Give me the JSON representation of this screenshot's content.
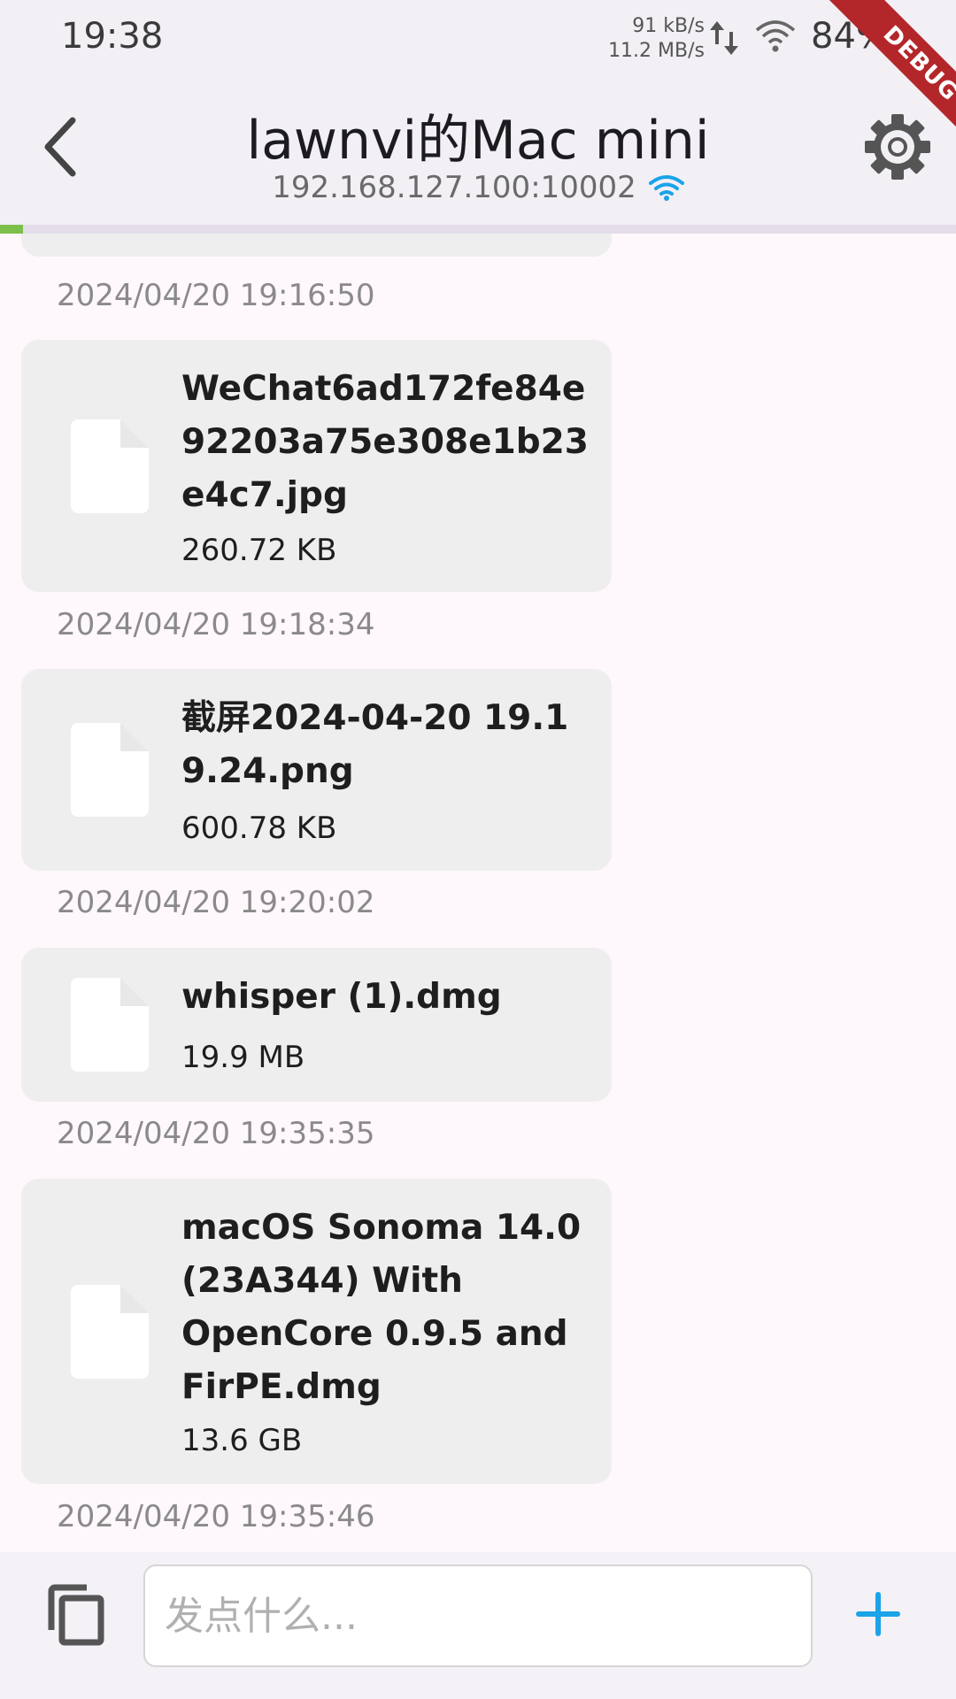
{
  "status_bar": {
    "time": "19:38",
    "upload_speed": "91 kB/s",
    "download_speed": "11.2 MB/s",
    "battery": "84%",
    "debug_label": "DEBUG"
  },
  "app_bar": {
    "title": "lawnvi的Mac mini",
    "address": "192.168.127.100:10002",
    "connection_color": "#1aa3e8",
    "progress_fraction": 0.024,
    "progress_color": "#7cc04b"
  },
  "messages": [
    {
      "name": "WeChat6ad172fe84e92203a75e308e1b23e4c7.jpg",
      "size": "260.72 KB",
      "time": "2024/04/20 19:18:34"
    },
    {
      "name": "截屏2024-04-20 19.19.24.png",
      "size": "600.78 KB",
      "time": "2024/04/20 19:20:02"
    },
    {
      "name": "whisper (1).dmg",
      "size": "19.9 MB",
      "time": "2024/04/20 19:35:35"
    },
    {
      "name": "macOS Sonoma 14.0 (23A344) With OpenCore 0.9.5 and FirPE.dmg",
      "size": "13.6 GB",
      "time": "2024/04/20 19:35:46"
    }
  ],
  "previous_message_time": "2024/04/20 19:16:50",
  "composer": {
    "placeholder": "发点什么...",
    "value": "",
    "accent_color": "#1aa3e8"
  },
  "icons": [
    "back-arrow-icon",
    "gear-icon",
    "wifi-icon",
    "file-icon",
    "copy-icon",
    "plus-icon"
  ]
}
